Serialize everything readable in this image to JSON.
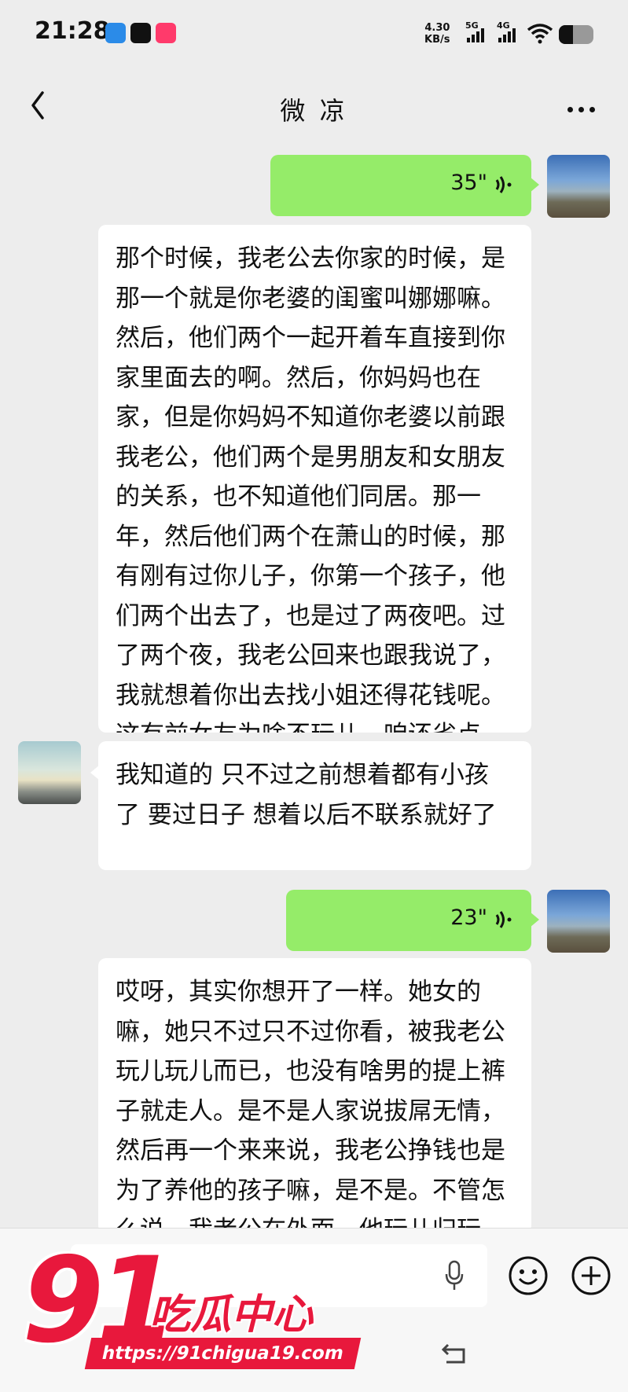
{
  "status_bar": {
    "time": "21:28",
    "net_speed_value": "4.30",
    "net_speed_unit": "KB/s",
    "signal1_label": "5G",
    "signal2_label": "4G",
    "battery_level": 0.4
  },
  "header": {
    "title": "微 凉"
  },
  "messages": [
    {
      "side": "self",
      "type": "voice",
      "duration": "35\""
    },
    {
      "side": "self",
      "type": "text",
      "text": "那个时候，我老公去你家的时候，是那一个就是你老婆的闺蜜叫娜娜嘛。然后，他们两个一起开着车直接到你家里面去的啊。然后，你妈妈也在家，但是你妈妈不知道你老婆以前跟我老公，他们两个是男朋友和女朋友的关系，也不知道他们同居。那一年，然后他们两个在萧山的时候，那有刚有过你儿子，你第一个孩子，他们两个出去了，也是过了两夜吧。过了两个夜，我老公回来也跟我说了，我就想着你出去找小姐还得花钱呢。这有前女友为啥不玩儿，咱还省点钱。"
    },
    {
      "side": "other",
      "type": "text",
      "text": "我知道的 只不过之前想着都有小孩了 要过日子 想着以后不联系就好了"
    },
    {
      "side": "self",
      "type": "voice",
      "duration": "23\""
    },
    {
      "side": "self",
      "type": "text",
      "text": "哎呀，其实你想开了一样。她女的嘛，她只不过只不过你看，被我老公玩儿玩儿而已，也没有啥男的提上裤子就走人。是不是人家说拔屌无情，然后再一个来来说，我老公挣钱也是为了养他的孩子嘛，是不是。不管怎么说，我老公在外面，他玩儿归玩儿，闹归闹，但是他挣"
    }
  ],
  "watermark": {
    "number": "91",
    "brand": "吃瓜中心",
    "url": "https://91chigua19.com"
  },
  "colors": {
    "self_bubble": "#95ec69",
    "other_bubble": "#ffffff",
    "background": "#ededed",
    "watermark": "#e8183c"
  },
  "icons": [
    "back-icon",
    "more-icon",
    "voice-wave-icon",
    "mic-icon",
    "emoji-icon",
    "plus-icon",
    "nav-back-icon"
  ]
}
